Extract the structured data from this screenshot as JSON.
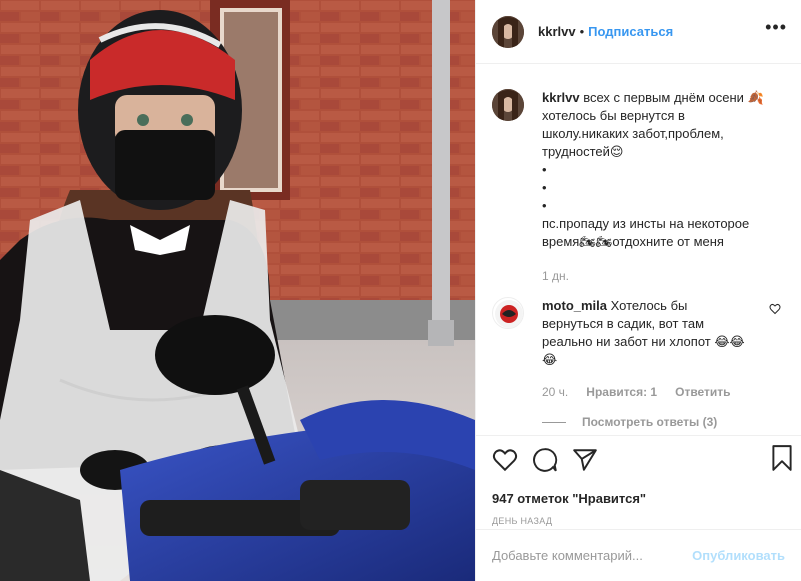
{
  "post": {
    "author": "kkrlvv",
    "follow_label": "Подписаться",
    "more_label": "•••"
  },
  "caption": {
    "author": "kkrlvv",
    "text_line1": "всех с первым днём осени 🍂",
    "text_line2": "хотелось бы вернутся в",
    "text_line3": "школу.никаких забот,проблем,",
    "text_line4": "трудностей😌",
    "dot1": "•",
    "dot2": "•",
    "dot3": "•",
    "text_line5": "пс.пропаду из инсты на некоторое",
    "text_line6": "время🏍🏍отдохните от меня",
    "time": "1 дн."
  },
  "comment": {
    "author": "moto_mila",
    "text_line1": "Хотелось бы",
    "text_line2": "вернуться в садик, вот там",
    "text_line3": "реально ни забот ни хлопот 😂😂",
    "text_line4": "😂",
    "time": "20 ч.",
    "likes_label": "Нравится: 1",
    "reply_label": "Ответить",
    "view_replies": "Посмотреть ответы (3)"
  },
  "footer": {
    "likes": "947 отметок \"Нравится\"",
    "date": "День назад",
    "comment_placeholder": "Добавьте комментарий...",
    "publish_label": "Опубликовать"
  },
  "colors": {
    "accent": "#3897f0",
    "publish_disabled": "#b2dffc",
    "muted": "#999999"
  },
  "icons": {
    "like": "heart-icon",
    "comment": "comment-icon",
    "share": "share-icon",
    "save": "bookmark-icon",
    "more": "more-icon"
  }
}
